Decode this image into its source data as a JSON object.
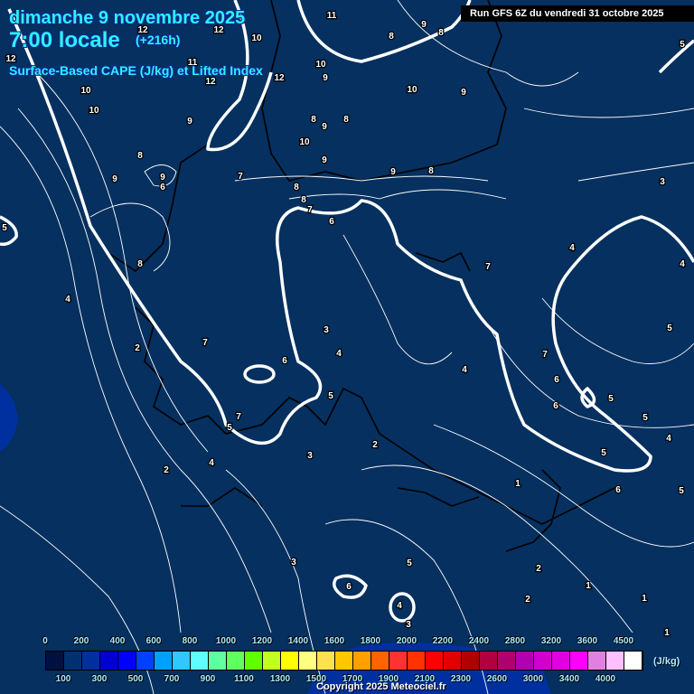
{
  "header": {
    "date": "dimanche 9 novembre 2025",
    "time": "7:00 locale",
    "lead": "(+216h)",
    "product": "Surface-Based CAPE (J/kg) et Lifted Index",
    "run": "Run GFS 6Z du vendredi 31 octobre 2025"
  },
  "colorbar": {
    "unit": "(J/kg)",
    "top_labels": [
      "0",
      "200",
      "400",
      "600",
      "800",
      "1000",
      "1200",
      "1400",
      "1600",
      "1800",
      "2000",
      "2200",
      "2400",
      "2800",
      "3200",
      "3600",
      "4500"
    ],
    "bottom_labels": [
      "100",
      "300",
      "500",
      "700",
      "900",
      "1100",
      "1300",
      "1500",
      "1700",
      "1900",
      "2100",
      "2300",
      "2600",
      "3000",
      "3400",
      "4000"
    ],
    "colors": [
      "#001040",
      "#003070",
      "#0030a0",
      "#0000d0",
      "#0000ff",
      "#0040ff",
      "#00a0ff",
      "#30c8ff",
      "#60ffff",
      "#60ffa0",
      "#60ff60",
      "#60ff00",
      "#c0ff20",
      "#ffff00",
      "#ffff80",
      "#ffe050",
      "#ffc800",
      "#ffa000",
      "#ff6400",
      "#ff3232",
      "#ff3200",
      "#ff0000",
      "#e00000",
      "#b00000",
      "#b00040",
      "#b00070",
      "#b000b0",
      "#d000d0",
      "#e000e0",
      "#ff00ff",
      "#e080e0",
      "#ffc0ff",
      "#ffffff"
    ]
  },
  "contour_labels": [
    "11",
    "12",
    "10",
    "11",
    "12",
    "12",
    "10",
    "9",
    "8",
    "8",
    "10",
    "9",
    "10",
    "12",
    "9",
    "8",
    "9",
    "8",
    "10",
    "9",
    "9",
    "8",
    "9",
    "9",
    "6",
    "7",
    "8",
    "8",
    "7",
    "6",
    "5",
    "4",
    "5",
    "8",
    "4",
    "2",
    "7",
    "6",
    "3",
    "4",
    "5",
    "7",
    "6",
    "2",
    "2",
    "3",
    "3",
    "5",
    "6",
    "4",
    "4",
    "5",
    "4",
    "7",
    "6",
    "7",
    "5",
    "5",
    "5",
    "4",
    "1",
    "6",
    "5",
    "3",
    "2",
    "2",
    "1",
    "1",
    "1",
    "9",
    "8",
    "10",
    "12",
    "4",
    "5",
    "3"
  ],
  "copyright": "Copyright 2025 Meteociel.fr"
}
